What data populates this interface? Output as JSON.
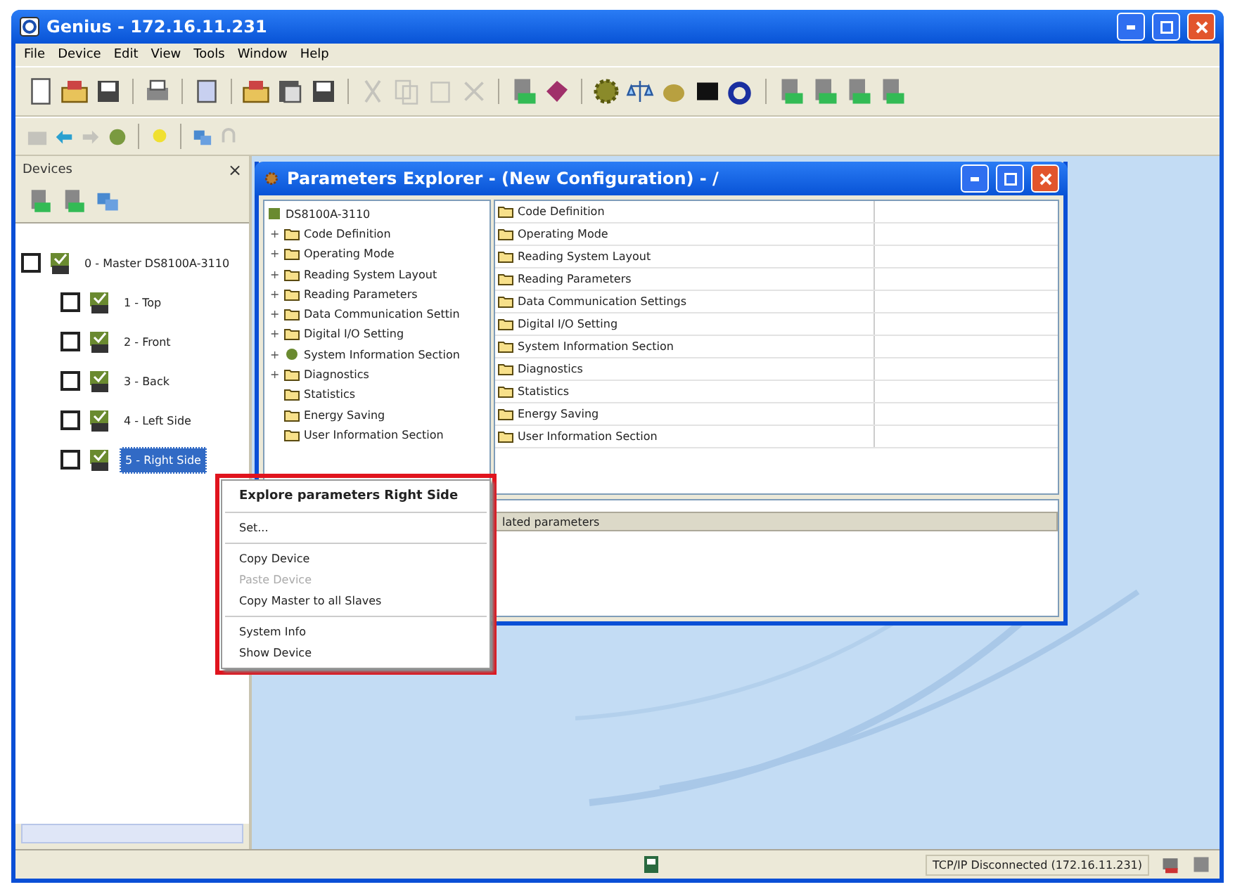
{
  "window": {
    "title": "Genius - 172.16.11.231"
  },
  "menu_bar": [
    "File",
    "Device",
    "Edit",
    "View",
    "Tools",
    "Window",
    "Help"
  ],
  "toolbar_main": [
    {
      "disabled": false
    },
    {
      "disabled": false
    },
    {
      "disabled": false
    },
    {
      "disabled": false
    },
    {
      "disabled": false
    },
    {
      "disabled": false
    },
    {
      "disabled": false
    },
    {
      "disabled": false
    },
    {
      "disabled": true
    },
    {
      "disabled": true
    },
    {
      "disabled": true
    },
    {
      "disabled": true
    },
    {
      "disabled": false
    },
    {
      "disabled": false
    },
    {
      "disabled": false
    },
    {
      "disabled": false
    },
    {
      "disabled": false
    },
    {
      "disabled": false
    },
    {
      "disabled": false
    },
    {
      "disabled": false
    },
    {
      "disabled": false
    },
    {
      "disabled": false
    },
    {
      "disabled": false
    }
  ],
  "toolbar_secondary": [
    {
      "disabled": true
    },
    {
      "disabled": false
    },
    {
      "disabled": true
    },
    {
      "disabled": false
    },
    {
      "disabled": false
    },
    {
      "disabled": false
    },
    {
      "disabled": true
    }
  ],
  "devices_panel": {
    "title": "Devices",
    "close": "×",
    "tree": {
      "label": "0 - Master DS8100A-3110",
      "checked": false,
      "selected": false,
      "children": [
        {
          "label": "1 - Top",
          "checked": false,
          "selected": false
        },
        {
          "label": "2 - Front",
          "checked": false,
          "selected": false
        },
        {
          "label": "3 - Back",
          "checked": false,
          "selected": false
        },
        {
          "label": "4 - Left Side",
          "checked": false,
          "selected": false
        },
        {
          "label": "5 - Right Side",
          "checked": false,
          "selected": true
        }
      ]
    }
  },
  "parameters_explorer": {
    "title": "Parameters Explorer - (New Configuration) - /",
    "tree": {
      "label": "DS8100A-3110",
      "children": [
        {
          "label": "Code Definition",
          "kind": "group",
          "toggle": "+"
        },
        {
          "label": "Operating Mode",
          "kind": "group",
          "toggle": "+"
        },
        {
          "label": "Reading System Layout",
          "kind": "group",
          "toggle": "+"
        },
        {
          "label": "Reading Parameters",
          "kind": "group",
          "toggle": "+"
        },
        {
          "label": "Data Communication Settin",
          "kind": "group",
          "toggle": "+"
        },
        {
          "label": "Digital I/O Setting",
          "kind": "group",
          "toggle": "+"
        },
        {
          "label": "System Information Section",
          "kind": "info",
          "toggle": "+"
        },
        {
          "label": "Diagnostics",
          "kind": "group",
          "toggle": "+"
        },
        {
          "label": "Statistics",
          "kind": "leaf"
        },
        {
          "label": "Energy Saving",
          "kind": "leaf"
        },
        {
          "label": "User Information Section",
          "kind": "leaf"
        }
      ]
    },
    "list": [
      "Code Definition",
      "Operating Mode",
      "Reading System Layout",
      "Reading Parameters",
      "Data Communication Settings",
      "Digital I/O Setting",
      "System Information Section",
      "Diagnostics",
      "Statistics",
      "Energy Saving",
      "User Information Section"
    ],
    "related_header": "lated parameters"
  },
  "context_menu": [
    [
      {
        "label": "Explore parameters Right Side",
        "default": true,
        "disabled": false
      }
    ],
    [
      {
        "label": "Set...",
        "default": false,
        "disabled": false
      }
    ],
    [
      {
        "label": "Copy Device",
        "default": false,
        "disabled": false
      },
      {
        "label": "Paste Device",
        "default": false,
        "disabled": true
      },
      {
        "label": "Copy Master to all Slaves",
        "default": false,
        "disabled": false
      }
    ],
    [
      {
        "label": "System Info",
        "default": false,
        "disabled": false
      },
      {
        "label": "Show Device",
        "default": false,
        "disabled": false
      }
    ]
  ],
  "status_bar": {
    "connection": "TCP/IP Disconnected (172.16.11.231)"
  }
}
